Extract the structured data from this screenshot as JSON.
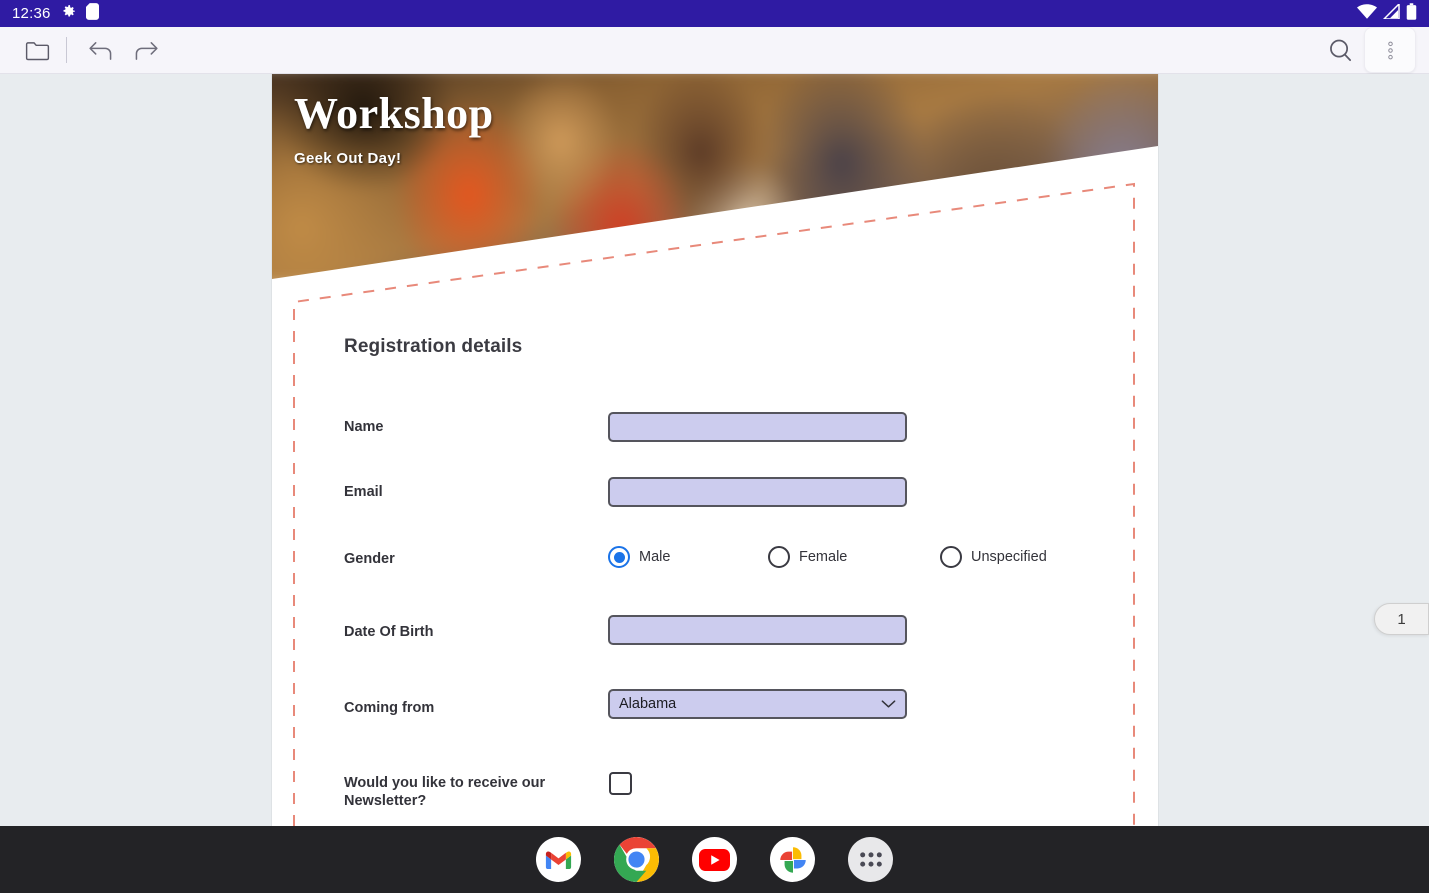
{
  "status_bar": {
    "clock": "12:36",
    "icons_left": [
      "settings-gear-icon",
      "sd-card-icon"
    ],
    "icons_right": [
      "wifi-icon",
      "cell-signal-icon",
      "battery-icon"
    ],
    "background_color": "#2f1ba3"
  },
  "toolbar": {
    "folder_label": "Open folder",
    "undo_label": "Undo",
    "redo_label": "Redo",
    "search_label": "Search",
    "menu_label": "More options",
    "background_color": "#f6f5fa"
  },
  "document": {
    "banner": {
      "title": "Workshop",
      "subtitle": "Geek Out Day!"
    },
    "form": {
      "heading": "Registration details",
      "fields": [
        {
          "label": "Name",
          "type": "text",
          "value": "",
          "placeholder": ""
        },
        {
          "label": "Email",
          "type": "text",
          "value": "",
          "placeholder": ""
        },
        {
          "label": "Gender",
          "type": "radio"
        },
        {
          "label": "Date Of Birth",
          "type": "text",
          "value": "",
          "placeholder": ""
        },
        {
          "label": "Coming from",
          "type": "select",
          "value": "Alabama"
        },
        {
          "label": "Would you like to receive our Newsletter?",
          "type": "checkbox",
          "checked": false
        }
      ],
      "gender_options": [
        {
          "label": "Male",
          "selected": true
        },
        {
          "label": "Female",
          "selected": false
        },
        {
          "label": "Unspecified",
          "selected": false
        }
      ],
      "selected_state": "Alabama",
      "newsletter_checked": false,
      "field_fill_color": "#ccccee",
      "field_border_color": "#55555d",
      "accent_color": "#1a73e8",
      "dashed_border_color": "#e8897a"
    }
  },
  "page_indicator": {
    "number": "1"
  },
  "dock": {
    "items": [
      {
        "name": "gmail",
        "label": "Gmail"
      },
      {
        "name": "chrome",
        "label": "Chrome"
      },
      {
        "name": "youtube",
        "label": "YouTube"
      },
      {
        "name": "google-photos",
        "label": "Photos"
      },
      {
        "name": "app-drawer",
        "label": "All apps"
      }
    ],
    "background_color": "#232326"
  }
}
